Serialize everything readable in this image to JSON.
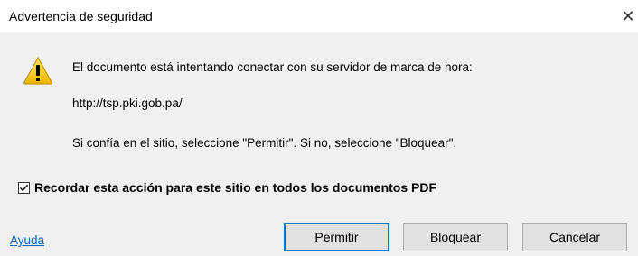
{
  "dialog": {
    "title": "Advertencia de seguridad",
    "close_symbol": "✕",
    "icon": "warning-icon",
    "message_line1": "El documento está intentando conectar con su servidor de marca de hora:",
    "url": "http://tsp.pki.gob.pa/",
    "message_line2": "Si confía en el sitio, seleccione \"Permitir\". Si no, seleccione \"Bloquear\".",
    "remember_label": "Recordar esta acción para este sitio en todos los documentos PDF",
    "remember_checked": true,
    "help_link": "Ayuda",
    "buttons": {
      "allow": "Permitir",
      "block": "Bloquear",
      "cancel": "Cancelar"
    }
  },
  "colors": {
    "background": "#f0f0f0",
    "titlebar": "#ffffff",
    "link": "#0a64c8",
    "default_button_border": "#0078d7",
    "warning_yellow": "#f5c400"
  }
}
